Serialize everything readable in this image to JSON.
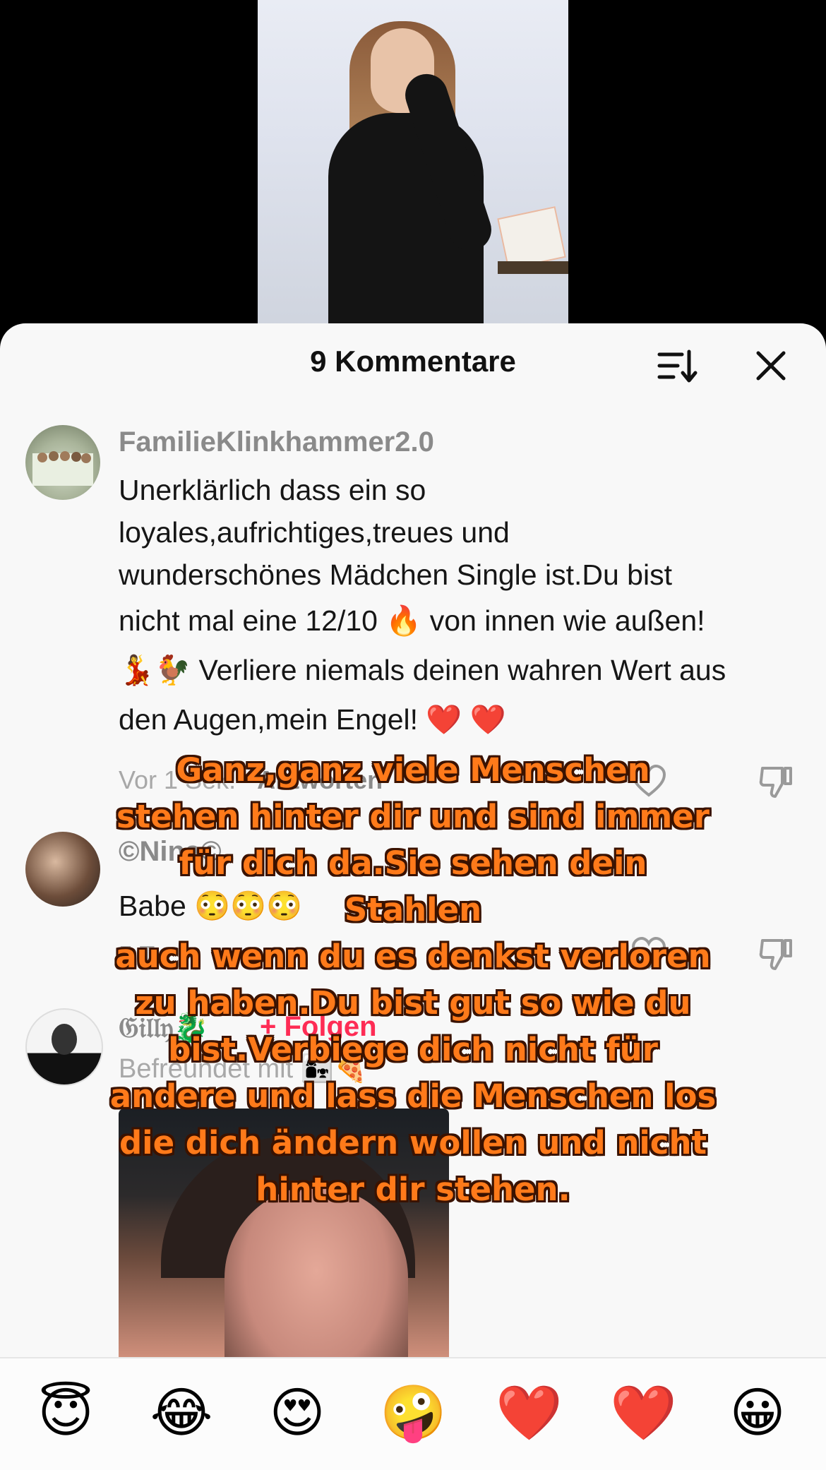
{
  "sheet": {
    "title": "9 Kommentare",
    "sort_icon": "sort-icon",
    "close_icon": "close-icon"
  },
  "comments": [
    {
      "user": "FamilieKlinkhammer2.0",
      "lines": [
        "Unerklärlich dass ein so",
        "loyales,aufrichtiges,treues und",
        "wunderschönes Mädchen Single ist.Du bist",
        "nicht mal eine 12/10 🔥 von innen wie außen!",
        "💃🐓 Verliere niemals deinen wahren Wert aus",
        "den Augen,mein Engel! ❤️ ❤️"
      ],
      "time": "Vor 1 Sek.",
      "reply": "Antworten"
    },
    {
      "user": "©Nina©",
      "text": "Babe 😳😳😳",
      "time": "5 T."
    },
    {
      "user": "𝔊𝔦𝔩𝔩𝔶🐉",
      "follow": "+ Folgen",
      "meta": "Befreundet mit 👩‍👧🍕"
    }
  ],
  "overlay_lines": [
    "Ganz,ganz viele Menschen",
    "stehen hinter dir und sind immer",
    "für dich da.Sie sehen dein Stahlen",
    "auch wenn du es denkst verloren",
    "zu haben.Du bist gut so wie du",
    "bist.Verbiege dich nicht für",
    "andere und lass die Menschen los",
    "die dich ändern wollen und nicht",
    "hinter dir stehen."
  ],
  "emoji_bar": [
    "😇",
    "😂",
    "😍",
    "🤪",
    "❤️",
    "❤️",
    "😀"
  ],
  "colors": {
    "accent_pink": "#fe2c55",
    "overlay_orange": "#ff7a1a",
    "sheet_bg": "#f8f8f8"
  }
}
